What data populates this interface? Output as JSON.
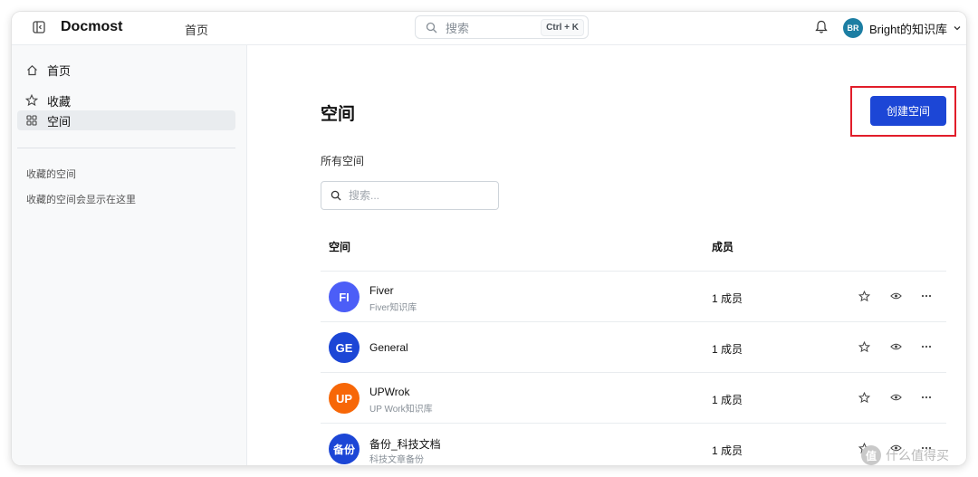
{
  "header": {
    "app_title": "Docmost",
    "nav_home": "首页",
    "search_label": "搜索",
    "search_shortcut": "Ctrl + K",
    "user_initials": "BR",
    "user_name": "Bright的知识库"
  },
  "sidebar": {
    "items": [
      {
        "label": "首页",
        "icon": "home-icon",
        "active": false
      },
      {
        "label": "收藏",
        "icon": "star-icon",
        "active": false
      },
      {
        "label": "空间",
        "icon": "grid-icon",
        "active": true
      }
    ],
    "favorites_title": "收藏的空间",
    "favorites_empty": "收藏的空间会显示在这里"
  },
  "main": {
    "title": "空间",
    "create_button": "创建空间",
    "section_label": "所有空间",
    "search_placeholder": "搜索...",
    "table": {
      "col_space": "空间",
      "col_members": "成员",
      "rows": [
        {
          "initials": "FI",
          "name": "Fiver",
          "desc": "Fiver知识库",
          "members": "1 成员",
          "color": "#4c5ef7"
        },
        {
          "initials": "GE",
          "name": "General",
          "desc": "",
          "members": "1 成员",
          "color": "#1c46d6"
        },
        {
          "initials": "UP",
          "name": "UPWrok",
          "desc": "UP Work知识库",
          "members": "1 成员",
          "color": "#f76707"
        },
        {
          "initials": "备份",
          "name": "备份_科技文档",
          "desc": "科技文章备份",
          "members": "1 成员",
          "color": "#1c46d6"
        }
      ]
    }
  },
  "colors": {
    "primary": "#1c46d6",
    "highlight_box": "#e11d2a"
  },
  "watermark": {
    "logo": "值",
    "text": "什么值得买"
  }
}
